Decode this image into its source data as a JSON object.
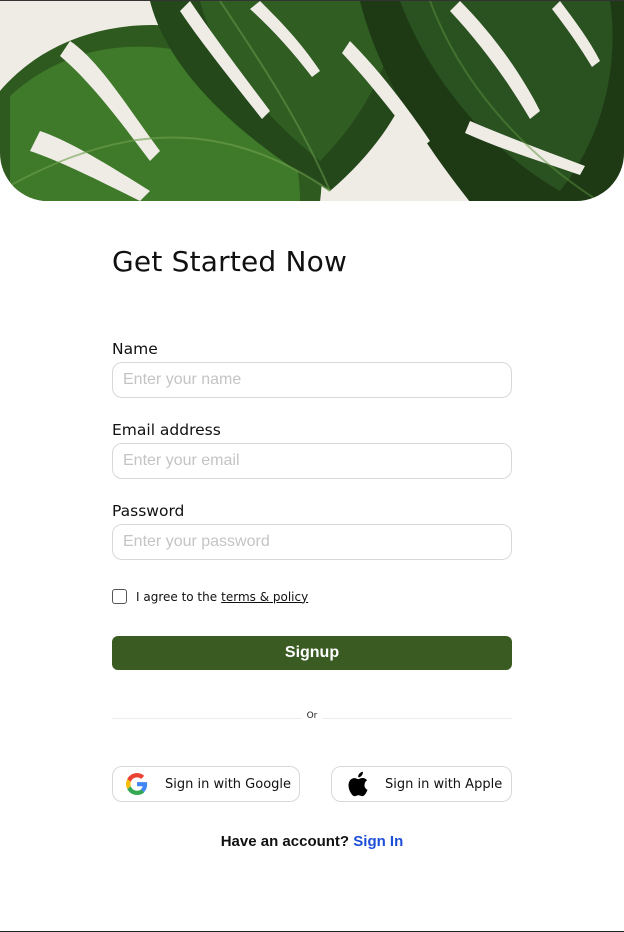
{
  "hero": {
    "image_name": "monstera-leaf-image",
    "colors": {
      "leaf_dark": "#1d3a14",
      "leaf_mid": "#2e5a1f",
      "leaf_light": "#4f8a34",
      "bg": "#efece6"
    }
  },
  "form": {
    "title": "Get Started Now",
    "fields": [
      {
        "label": "Name",
        "placeholder": "Enter your name",
        "value": ""
      },
      {
        "label": "Email address",
        "placeholder": "Enter your email",
        "value": ""
      },
      {
        "label": "Password",
        "placeholder": "Enter your password",
        "value": ""
      }
    ],
    "agree": {
      "text": "I agree to the",
      "link": "terms & policy",
      "checked": false
    },
    "signup_label": "Signup",
    "divider_text": "Or",
    "google_label": "Sign in with Google",
    "apple_label": "Sign in with Apple",
    "have_account_text": "Have an account?",
    "signin_link": "Sign In"
  },
  "colors": {
    "accent": "#3a5b22",
    "link": "#1d4ed8",
    "border": "#d8d8d8",
    "placeholder": "#c4c4c4"
  }
}
